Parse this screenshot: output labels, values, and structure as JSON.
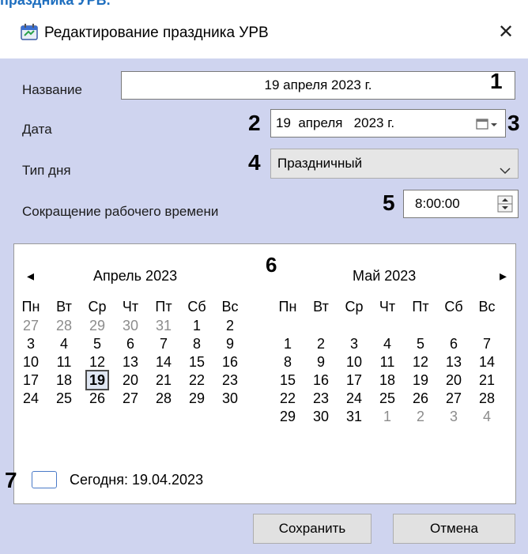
{
  "page_top_text": "праздника УРВ.",
  "window": {
    "title": "Редактирование праздника УРВ",
    "close_glyph": "✕"
  },
  "form": {
    "name_label": "Название",
    "name_value": "19 апреля 2023 г.",
    "date_label": "Дата",
    "date_value": "19  апреля   2023 г.",
    "daytype_label": "Тип дня",
    "daytype_value": "Праздничный",
    "reduction_label": "Сокращение рабочего времени",
    "reduction_value": "8:00:00"
  },
  "callouts": [
    "1",
    "2",
    "3",
    "4",
    "5",
    "6",
    "7"
  ],
  "calendar": {
    "prev_glyph": "◂",
    "next_glyph": "▸",
    "weekdays": [
      "Пн",
      "Вт",
      "Ср",
      "Чт",
      "Пт",
      "Сб",
      "Вс"
    ],
    "months": [
      {
        "title": "Апрель 2023",
        "rows": [
          [
            {
              "t": "27",
              "o": 1
            },
            {
              "t": "28",
              "o": 1
            },
            {
              "t": "29",
              "o": 1
            },
            {
              "t": "30",
              "o": 1
            },
            {
              "t": "31",
              "o": 1
            },
            {
              "t": "1"
            },
            {
              "t": "2"
            }
          ],
          [
            {
              "t": "3"
            },
            {
              "t": "4"
            },
            {
              "t": "5"
            },
            {
              "t": "6"
            },
            {
              "t": "7"
            },
            {
              "t": "8"
            },
            {
              "t": "9"
            }
          ],
          [
            {
              "t": "10"
            },
            {
              "t": "11"
            },
            {
              "t": "12"
            },
            {
              "t": "13"
            },
            {
              "t": "14"
            },
            {
              "t": "15"
            },
            {
              "t": "16"
            }
          ],
          [
            {
              "t": "17"
            },
            {
              "t": "18"
            },
            {
              "t": "19",
              "today": 1
            },
            {
              "t": "20"
            },
            {
              "t": "21"
            },
            {
              "t": "22"
            },
            {
              "t": "23"
            }
          ],
          [
            {
              "t": "24"
            },
            {
              "t": "25"
            },
            {
              "t": "26"
            },
            {
              "t": "27"
            },
            {
              "t": "28"
            },
            {
              "t": "29"
            },
            {
              "t": "30"
            }
          ]
        ]
      },
      {
        "title": "Май 2023",
        "rows": [
          [],
          [
            {
              "t": "1"
            },
            {
              "t": "2"
            },
            {
              "t": "3"
            },
            {
              "t": "4"
            },
            {
              "t": "5"
            },
            {
              "t": "6"
            },
            {
              "t": "7"
            }
          ],
          [
            {
              "t": "8"
            },
            {
              "t": "9"
            },
            {
              "t": "10"
            },
            {
              "t": "11"
            },
            {
              "t": "12"
            },
            {
              "t": "13"
            },
            {
              "t": "14"
            }
          ],
          [
            {
              "t": "15"
            },
            {
              "t": "16"
            },
            {
              "t": "17"
            },
            {
              "t": "18"
            },
            {
              "t": "19"
            },
            {
              "t": "20"
            },
            {
              "t": "21"
            }
          ],
          [
            {
              "t": "22"
            },
            {
              "t": "23"
            },
            {
              "t": "24"
            },
            {
              "t": "25"
            },
            {
              "t": "26"
            },
            {
              "t": "27"
            },
            {
              "t": "28"
            }
          ],
          [
            {
              "t": "29"
            },
            {
              "t": "30"
            },
            {
              "t": "31"
            },
            {
              "t": "1",
              "o": 1
            },
            {
              "t": "2",
              "o": 1
            },
            {
              "t": "3",
              "o": 1
            },
            {
              "t": "4",
              "o": 1
            }
          ]
        ]
      }
    ],
    "today_label": "Сегодня: 19.04.2023"
  },
  "buttons": {
    "save": "Сохранить",
    "cancel": "Отмена"
  },
  "icons": {
    "app": "calendar-app-icon",
    "date_picker": "calendar-dropdown-icon",
    "daytype": "chevron-down-icon",
    "spinner": "spin-up-down-icon"
  }
}
